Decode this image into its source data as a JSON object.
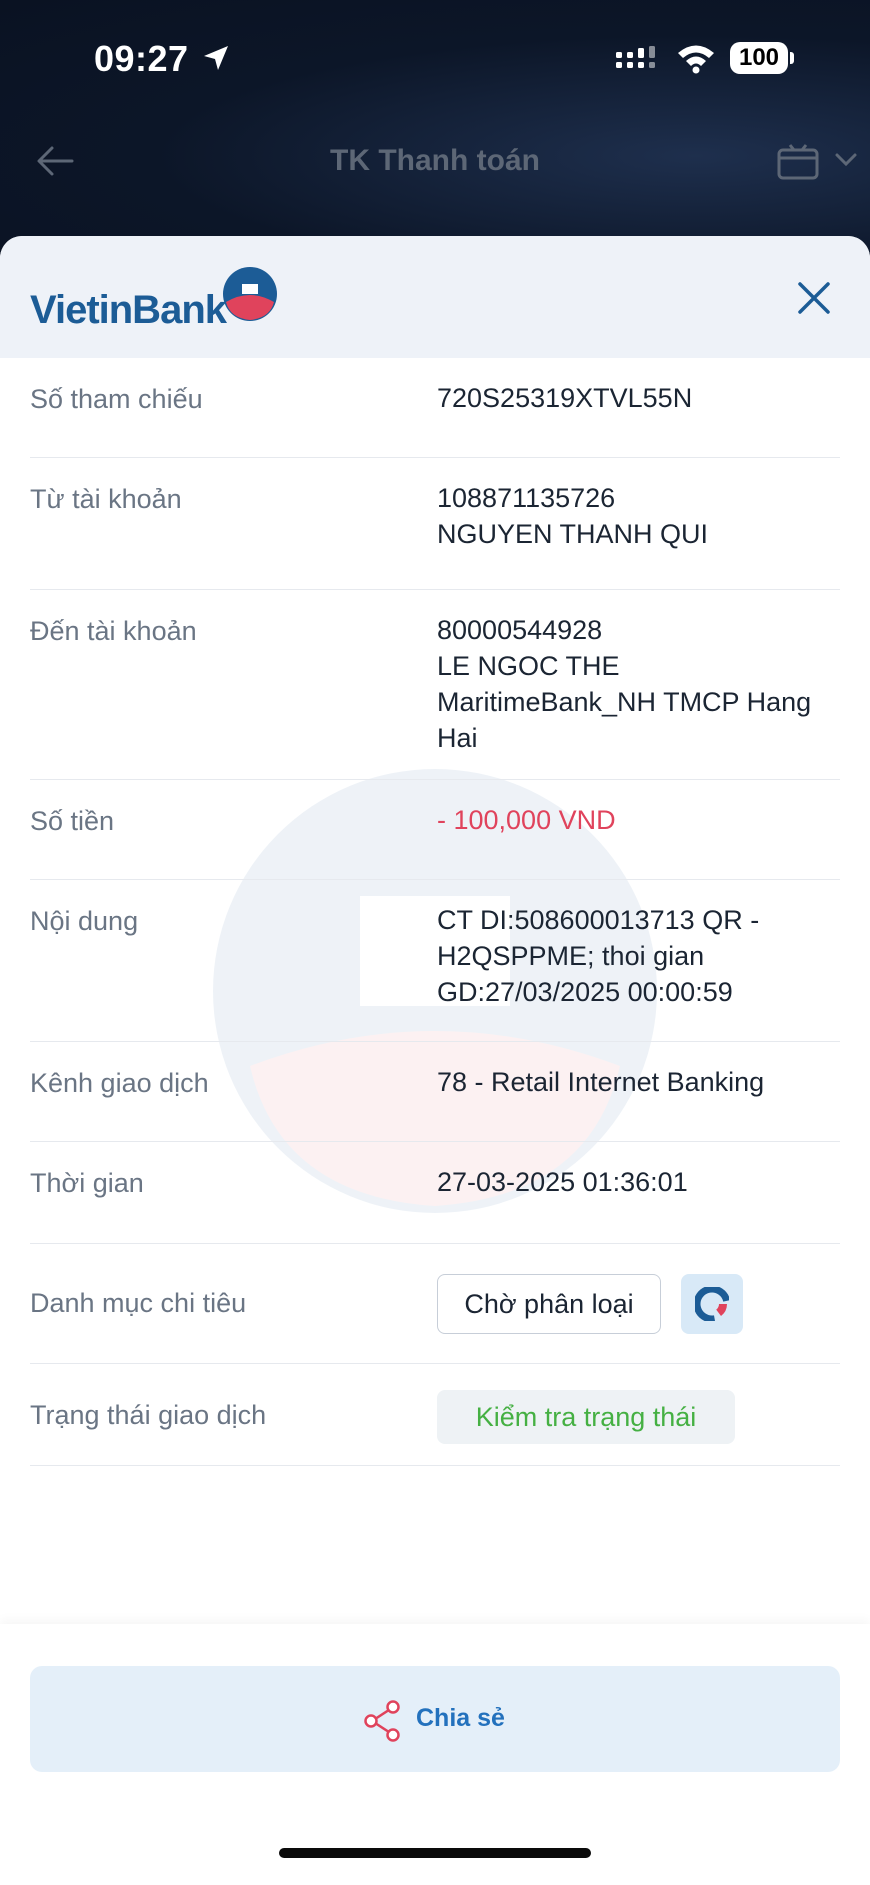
{
  "status_bar": {
    "time": "09:27",
    "battery": "100"
  },
  "app_header": {
    "title": "TK Thanh toán"
  },
  "sheet": {
    "logo_text": "VietinBank",
    "rows": [
      {
        "label": "Số tham chiếu",
        "value": "720S25319XTVL55N"
      },
      {
        "label": "Từ tài khoản",
        "line1": "108871135726",
        "line2": "NGUYEN THANH QUI"
      },
      {
        "label": "Đến tài khoản",
        "line1": "80000544928",
        "line2": "LE NGOC THE",
        "line3": "MaritimeBank_NH TMCP Hang Hai"
      },
      {
        "label": "Số tiền",
        "value": "- 100,000 VND"
      },
      {
        "label": "Nội dung",
        "value": "CT DI:508600013713 QR - H2QSPPME; thoi gian GD:27/03/2025 00:00:59"
      },
      {
        "label": "Kênh giao dịch",
        "value": "78 - Retail Internet Banking"
      },
      {
        "label": "Thời gian",
        "value": "27-03-2025 01:36:01"
      },
      {
        "label": "Danh mục chi tiêu",
        "button": "Chờ phân loại"
      },
      {
        "label": "Trạng thái giao dịch",
        "button": "Kiểm tra trạng thái"
      }
    ]
  },
  "footer": {
    "share_label": "Chia sẻ"
  },
  "colors": {
    "brand_blue": "#1c5c96",
    "amount_red": "#e0435c",
    "status_green": "#45b043",
    "share_blue": "#2371bd"
  },
  "icons": [
    "location-arrow-icon",
    "signal-icon",
    "wifi-icon",
    "back-arrow-icon",
    "calendar-icon",
    "chevron-down-icon",
    "close-icon",
    "pie-chart-icon",
    "share-icon"
  ]
}
